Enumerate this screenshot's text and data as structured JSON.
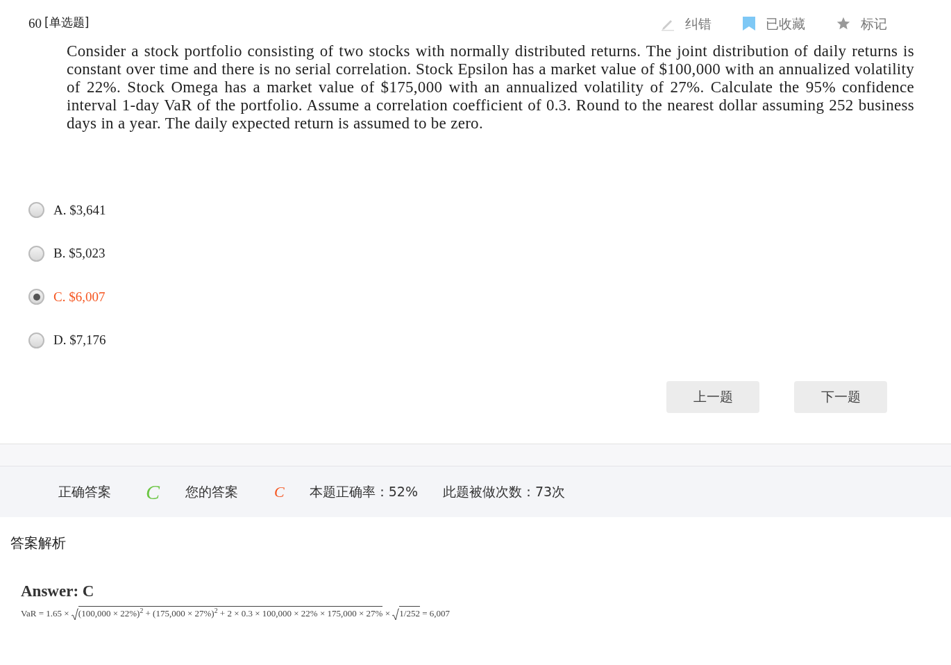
{
  "header": {
    "number": "60",
    "type": "[单选题]",
    "actions": [
      {
        "kind": "pencil",
        "label": "纠错",
        "selected": false
      },
      {
        "kind": "bookmark",
        "label": "已收藏",
        "selected": true
      },
      {
        "kind": "star",
        "label": "标记",
        "selected": false
      }
    ]
  },
  "question": "Consider a stock portfolio consisting of two stocks with normally distributed returns. The joint distribution of daily returns is constant over time and there is no serial correlation. Stock Epsilon has a market value of $100,000 with an annualized volatility of 22%. Stock Omega has a market value of $175,000 with an annualized volatility of 27%. Calculate the 95% confidence interval 1-day VaR of the portfolio. Assume a correlation coefficient of 0.3. Round to the nearest dollar assuming 252 business days in a year. The daily expected return is assumed to be zero.",
  "options": [
    {
      "label": "A. $3,641",
      "selected": false
    },
    {
      "label": "B. $5,023",
      "selected": false
    },
    {
      "label": "C. $6,007",
      "selected": true
    },
    {
      "label": "D. $7,176",
      "selected": false
    }
  ],
  "nav_buttons": [
    "上一题",
    "下一题"
  ],
  "result": {
    "correct_label": "正确答案",
    "correct_answer": "C",
    "your_label": "您的答案",
    "your_answer": "C",
    "accuracy": "本题正确率：52%",
    "attempts": "此题被做次数：73次"
  },
  "analysis": {
    "title": "答案解析",
    "answer": "Answer: C",
    "formula": [
      {
        "kind": "text",
        "text": "VaR = 1.65 × "
      },
      {
        "kind": "sqrt",
        "text": "(100,000 × 22%)$^{2}$ + (175,000 × 27%)$^{2}$ + 2 × 0.3 × 100,000 × 22% × 175,000 × 27%"
      },
      {
        "kind": "text",
        "text": " × "
      },
      {
        "kind": "sqrt",
        "text": "1/252"
      },
      {
        "kind": "text",
        "text": " = 6,007"
      }
    ]
  }
}
